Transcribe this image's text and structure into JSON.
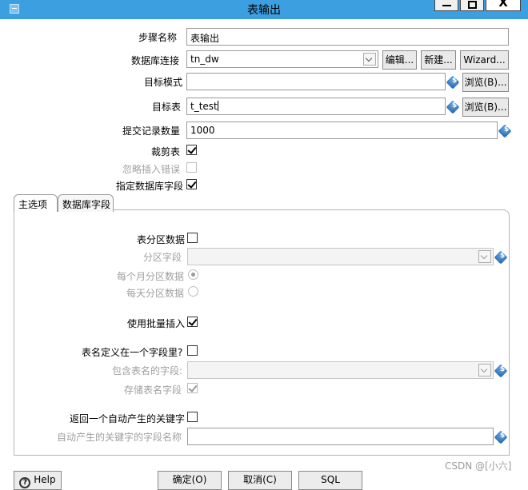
{
  "window": {
    "title": "表输出",
    "close_glyph": "X"
  },
  "form": {
    "step_name": {
      "label": "步骤名称",
      "value": "表输出"
    },
    "db_connection": {
      "label": "数据库连接",
      "value": "tn_dw",
      "edit_button": "编辑...",
      "new_button": "新建...",
      "wizard_button": "Wizard..."
    },
    "target_schema": {
      "label": "目标模式",
      "value": "",
      "browse_button": "浏览(B)..."
    },
    "target_table": {
      "label": "目标表",
      "value": "t_test",
      "browse_button": "浏览(B)..."
    },
    "commit_size": {
      "label": "提交记录数量",
      "value": "1000"
    },
    "truncate_table": {
      "label": "裁剪表",
      "checked": true
    },
    "ignore_insert_errors": {
      "label": "忽略插入错误",
      "checked": false,
      "disabled": true
    },
    "specify_db_fields": {
      "label": "指定数据库字段",
      "checked": true
    }
  },
  "tabs": [
    {
      "label": "主选项",
      "active": true
    },
    {
      "label": "数据库字段",
      "active": false
    }
  ],
  "main_options": {
    "partition_data": {
      "label": "表分区数据",
      "checked": false
    },
    "partition_field": {
      "label": "分区字段",
      "value": ""
    },
    "partition_monthly": {
      "label": "每个月分区数据",
      "selected": true
    },
    "partition_daily": {
      "label": "每天分区数据",
      "selected": false
    },
    "use_batch_insert": {
      "label": "使用批量插入",
      "checked": true
    },
    "table_name_in_field": {
      "label": "表名定义在一个字段里?",
      "checked": false
    },
    "field_containing_table_name": {
      "label": "包含表名的字段:",
      "value": ""
    },
    "store_table_name_field": {
      "label": "存储表名字段",
      "checked": true
    },
    "return_auto_key": {
      "label": "返回一个自动产生的关键字",
      "checked": false
    },
    "auto_key_field_name": {
      "label": "自动产生的关键字的字段名称",
      "value": ""
    }
  },
  "buttons": {
    "help": "Help",
    "ok": "确定(O)",
    "cancel": "取消(C)",
    "sql": "SQL"
  },
  "watermark": "CSDN @[小六]",
  "colors": {
    "titlebar": "#3c9fe0",
    "disabled_text": "#a0a0a0"
  },
  "icons": [
    "variable-icon",
    "dropdown-arrow-icon",
    "checkmark-icon",
    "help-icon",
    "app-icon"
  ]
}
